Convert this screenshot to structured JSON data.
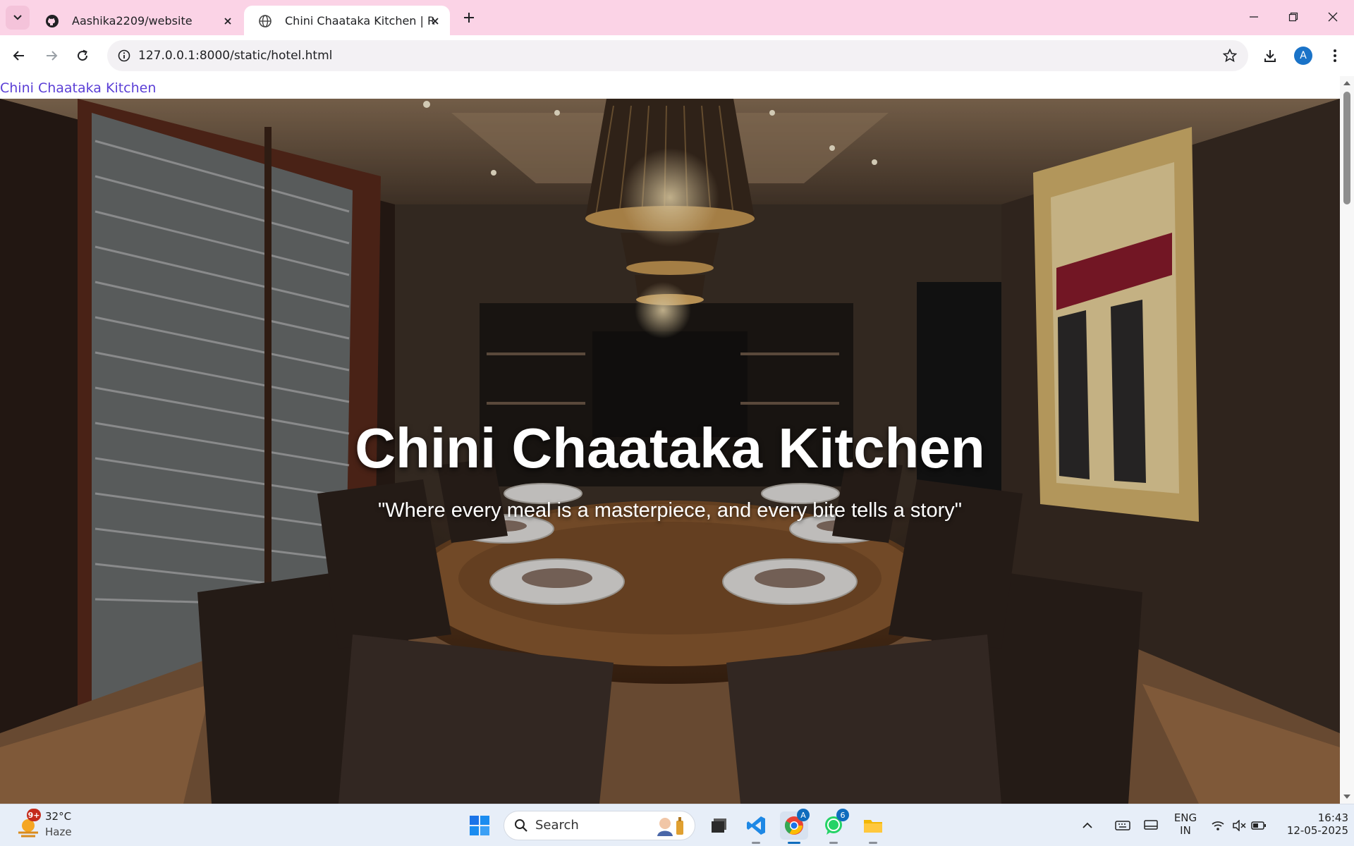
{
  "browser": {
    "tabs": [
      {
        "title": "Aashika2209/website",
        "icon": "github-icon"
      },
      {
        "title": "Chini Chaataka Kitchen | Restaurant",
        "icon": "globe-icon"
      }
    ],
    "url": "127.0.0.1:8000/static/hotel.html",
    "profile_initial": "A"
  },
  "page": {
    "top_link": "Chini Chaataka Kitchen",
    "hero_title": "Chini Chaataka Kitchen",
    "hero_subtitle": "\"Where every meal is a masterpiece, and every bite tells a story\""
  },
  "taskbar": {
    "weather_badge": "9+",
    "temperature": "32°C",
    "condition": "Haze",
    "search_label": "Search",
    "vscode_badge": "",
    "chrome_badge": "A",
    "whatsapp_badge": "6",
    "language_line1": "ENG",
    "language_line2": "IN",
    "time": "16:43",
    "date": "12-05-2025"
  },
  "colors": {
    "tab_strip": "#fbd3e6",
    "link": "#5b3fd6",
    "taskbar": "#e7eef8"
  }
}
